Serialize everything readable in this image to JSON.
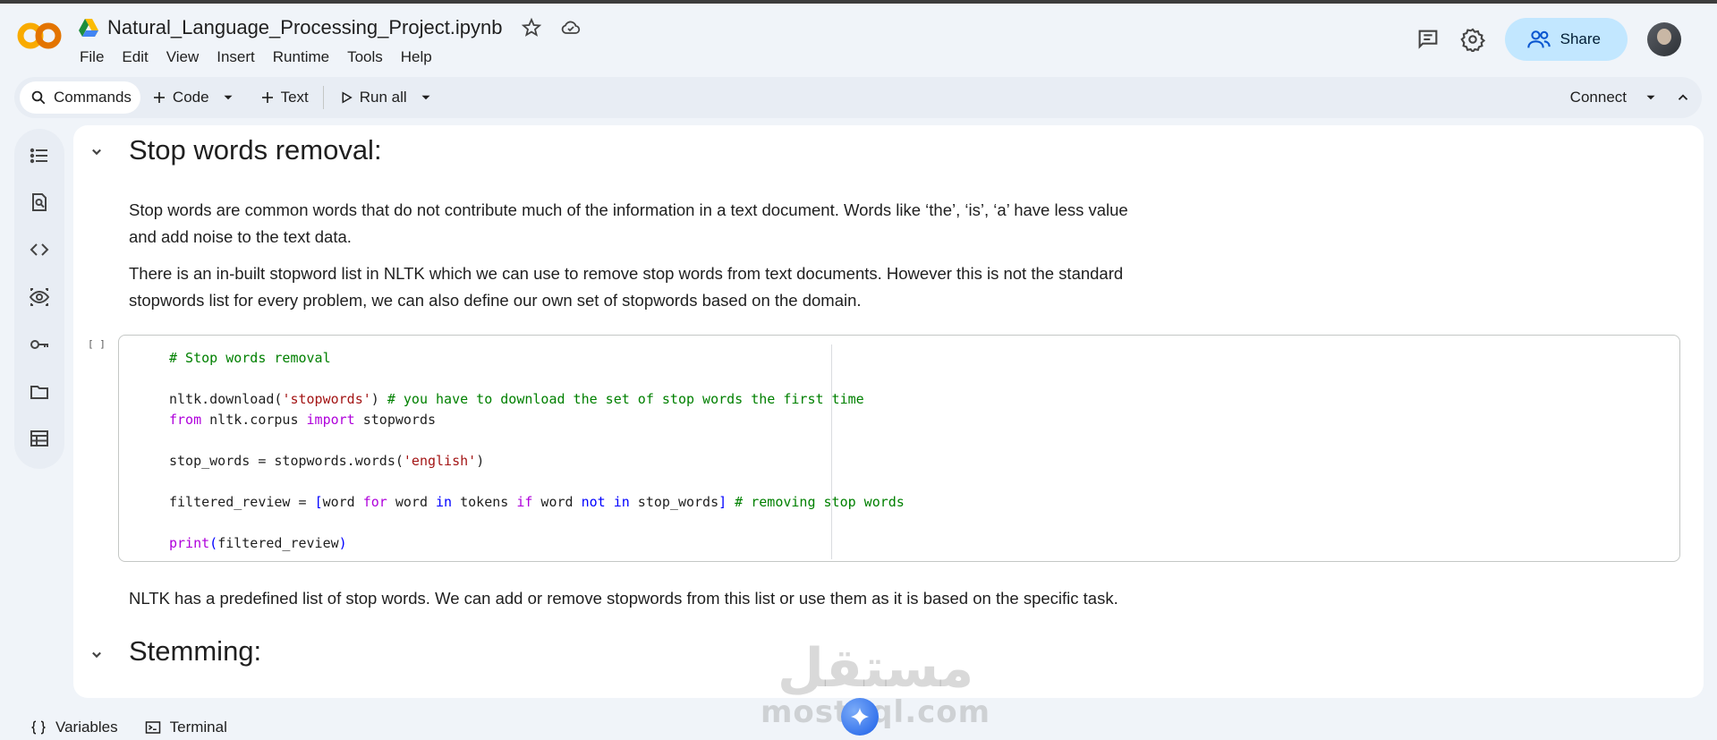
{
  "notebook": {
    "title": "Natural_Language_Processing_Project.ipynb"
  },
  "menu": [
    "File",
    "Edit",
    "View",
    "Insert",
    "Runtime",
    "Tools",
    "Help"
  ],
  "header": {
    "share_label": "Share"
  },
  "toolbar": {
    "commands_label": "Commands",
    "code_label": "Code",
    "text_label": "Text",
    "run_all_label": "Run all",
    "connect_label": "Connect"
  },
  "content": {
    "heading_stop": "Stop words removal:",
    "para1_line1": "Stop words are common words that do not contribute much of the information in a text document. Words like ‘the’, ‘is’, ‘a’ have less value",
    "para1_line2": "and add noise to the text data.",
    "para2_line1": "There is an in-built stopword list in NLTK which we can use to remove stop words from text documents. However this is not the standard",
    "para2_line2": "stopwords list for every problem, we can also define our own set of stopwords based on the domain.",
    "cell_bracket": "[ ]",
    "para3": "NLTK has a predefined list of stop words. We can add or remove stopwords from this list or use them as it is based on the specific task.",
    "heading_stem": "Stemming:"
  },
  "code": {
    "l1_comment": "# Stop words removal",
    "l3_a": "nltk.download(",
    "l3_str": "'stopwords'",
    "l3_b": ") ",
    "l3_comment": "# you have to download the set of stop words the first time",
    "l4_from": "from",
    "l4_mod": " nltk.corpus ",
    "l4_import": "import",
    "l4_name": " stopwords",
    "l6_a": "stop_words = stopwords.words(",
    "l6_str": "'english'",
    "l6_b": ")",
    "l8_a": "filtered_review = ",
    "l8_lb": "[",
    "l8_word": "word ",
    "l8_for": "for",
    "l8_word2": " word ",
    "l8_in": "in",
    "l8_tokens": " tokens ",
    "l8_if": "if",
    "l8_word3": " word ",
    "l8_notin": "not in",
    "l8_sw": " stop_words",
    "l8_rb": "]",
    "l8_comment": " # removing stop words",
    "l10_print": "print",
    "l10_lp": "(",
    "l10_arg": "filtered_review",
    "l10_rp": ")"
  },
  "statusbar": {
    "variables_label": "Variables",
    "terminal_label": "Terminal"
  },
  "watermark": {
    "arabic": "مستقل",
    "latin": "mostaql.com"
  },
  "colors": {
    "accent_share": "#c2e7ff",
    "logo_orange": "#f9ab00",
    "logo_dark": "#e37400",
    "code_comment": "#008000",
    "code_string": "#a31515",
    "code_keyword": "#af00db",
    "code_operator": "#0000ff"
  }
}
